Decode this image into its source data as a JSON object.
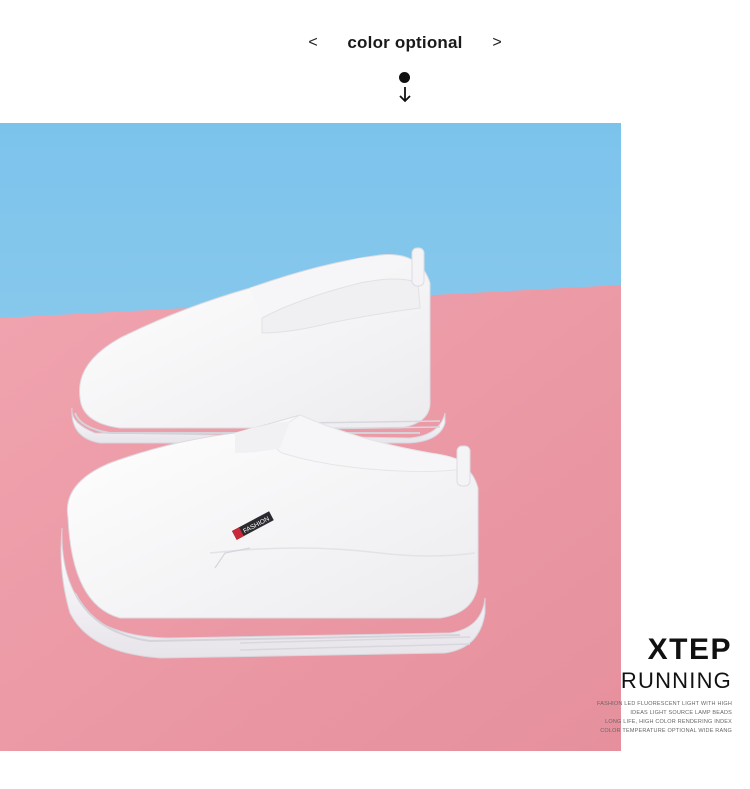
{
  "header": {
    "prev_label": "<",
    "title": "color optional",
    "next_label": ">"
  },
  "photo": {
    "description_icon": "white-slip-on-shoes-icon",
    "background_colors": {
      "wall": "#84c6ea",
      "floor": "#ec9ba7"
    },
    "tag_text": "FASHION"
  },
  "brand": {
    "name": "XTEP",
    "subtitle": "RUNNING",
    "desc_lines": [
      "FASHION LED FLUORESCENT LIGHT WITH HIGH",
      "IDEAS LIGHT SOURCE LAMP BEADS",
      "LONG LIFE, HIGH COLOR RENDERING INDEX",
      "COLOR TEMPERATURE OPTIONAL WIDE RANG"
    ]
  }
}
